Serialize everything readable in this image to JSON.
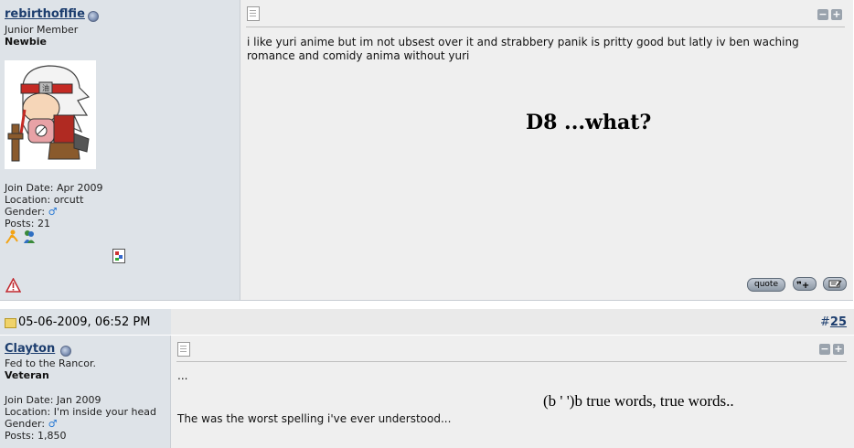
{
  "post1": {
    "username": "rebirthoflfie",
    "user_title": "Junior Member",
    "rank": "Newbie",
    "join_date": "Join Date: Apr 2009",
    "location": "Location: orcutt",
    "gender_label": "Gender:",
    "gender_symbol": "♂",
    "posts": "Posts: 21",
    "message": "i like yuri anime but im not ubsest over it and strabbery panik is pritty good but latly iv ben waching romance and comidy anima without yuri",
    "big_text": "D8 ...what?",
    "minus": "−",
    "plus": "+",
    "quote_button": "quote"
  },
  "post2": {
    "date": "05-06-2009, 06:52 PM",
    "post_number_prefix": "#",
    "post_number": "25",
    "username": "Clayton",
    "user_title": "Fed to the Rancor.",
    "rank": "Veteran",
    "join_date": "Join Date: Jan 2009",
    "location": "Location: I'm inside your head",
    "gender_label": "Gender:",
    "gender_symbol": "♂",
    "posts": "Posts: 1,850",
    "ellipsis": "...",
    "quote_text": "(b ' ')b true words, true words..",
    "message": "The was the worst spelling i've ever understood...",
    "minus": "−",
    "plus": "+"
  },
  "colors": {
    "sidebar_bg": "#dee3e8",
    "content_bg": "#efefef",
    "username": "#1c3d6e"
  }
}
